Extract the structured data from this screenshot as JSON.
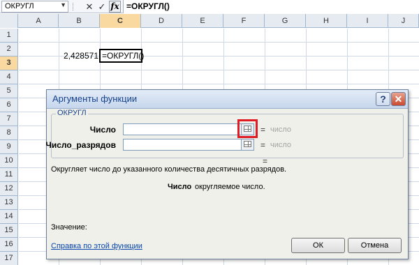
{
  "formula_bar": {
    "name_box": "ОКРУГЛ",
    "cancel_glyph": "✕",
    "enter_glyph": "✓",
    "fx_label": "fx",
    "formula": "=ОКРУГЛ()"
  },
  "columns": [
    "A",
    "B",
    "C",
    "D",
    "E",
    "F",
    "G",
    "H",
    "I",
    "J"
  ],
  "selected_column": "C",
  "rows": [
    "1",
    "2",
    "3",
    "4",
    "5",
    "6",
    "7",
    "8",
    "9",
    "10",
    "11",
    "12",
    "13",
    "14",
    "15",
    "16",
    "17"
  ],
  "selected_row": "3",
  "cells": {
    "B3": "2,428571",
    "C3": "=ОКРУГЛ()"
  },
  "dialog": {
    "title": "Аргументы функции",
    "help_glyph": "?",
    "close_glyph": "✕",
    "group_label": "ОКРУГЛ",
    "args": [
      {
        "label": "Число",
        "value": "",
        "equals": "=",
        "result": "число"
      },
      {
        "label": "Число_разрядов",
        "value": "",
        "equals": "=",
        "result": "число"
      }
    ],
    "function_equals": "=",
    "description": "Округляет число до указанного количества десятичных разрядов.",
    "arg_desc_name": "Число",
    "arg_desc_text": "округляемое число.",
    "result_label": "Значение:",
    "help_link": "Справка по этой функции",
    "ok_label": "ОК",
    "cancel_label": "Отмена"
  },
  "colors": {
    "highlight": "#e01b24",
    "selected_header": "#f9d99f"
  }
}
